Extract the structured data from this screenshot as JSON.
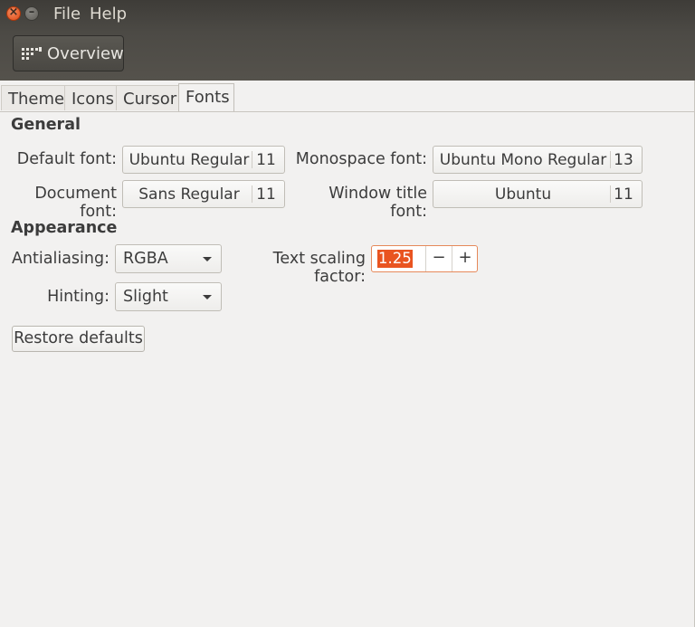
{
  "menu": {
    "file": "File",
    "help": "Help"
  },
  "toolbar": {
    "overview_label": "Overview"
  },
  "tabs": [
    {
      "label": "Theme"
    },
    {
      "label": "Icons"
    },
    {
      "label": "Cursor"
    },
    {
      "label": "Fonts",
      "active": true
    }
  ],
  "general": {
    "heading": "General",
    "default_font": {
      "label": "Default font:",
      "name": "Ubuntu Regular",
      "size": "11"
    },
    "monospace_font": {
      "label": "Monospace font:",
      "name": "Ubuntu Mono Regular",
      "size": "13"
    },
    "document_font": {
      "label": "Document font:",
      "name": "Sans Regular",
      "size": "11"
    },
    "window_title_font": {
      "label": "Window title font:",
      "name": "Ubuntu",
      "size": "11"
    }
  },
  "appearance": {
    "heading": "Appearance",
    "antialiasing": {
      "label": "Antialiasing:",
      "value": "RGBA"
    },
    "hinting": {
      "label": "Hinting:",
      "value": "Slight"
    },
    "text_scaling": {
      "label": "Text scaling factor:",
      "value": "1.25",
      "minus": "−",
      "plus": "+"
    }
  },
  "restore_label": "Restore defaults",
  "colors": {
    "accent": "#e95420",
    "titlebar": "#4a4843",
    "background": "#f2f1f0"
  }
}
